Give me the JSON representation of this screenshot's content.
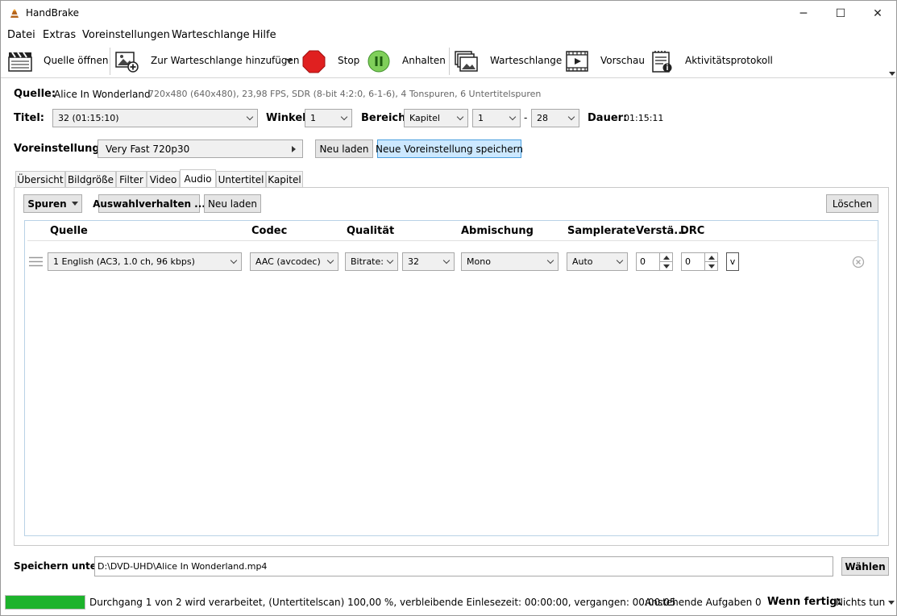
{
  "window": {
    "title": "HandBrake",
    "controls": {
      "minimize": "─",
      "maximize": "☐",
      "close": "✕"
    }
  },
  "menu": [
    "Datei",
    "Extras",
    "Voreinstellungen",
    "Warteschlange",
    "Hilfe"
  ],
  "toolbar": {
    "open_source": "Quelle öffnen",
    "add_to_queue": "Zur Warteschlange hinzufügen",
    "stop": "Stop",
    "pause": "Anhalten",
    "queue": "Warteschlange",
    "preview": "Vorschau",
    "activity_log": "Aktivitätsprotokoll"
  },
  "source": {
    "label": "Quelle:",
    "name": "Alice In Wonderland",
    "info": "720x480 (640x480), 23,98 FPS, SDR (8-bit 4:2:0, 6-1-6), 4 Tonspuren, 6 Untertitelspuren"
  },
  "title_row": {
    "title_label": "Titel:",
    "title_value": "32  (01:15:10)",
    "angle_label": "Winkel:",
    "angle_value": "1",
    "range_label": "Bereich:",
    "range_type": "Kapitel",
    "range_from": "1",
    "range_sep": "-",
    "range_to": "28",
    "duration_label": "Dauer:",
    "duration_value": "01:15:11"
  },
  "preset": {
    "label": "Voreinstellung:",
    "value": "Very Fast 720p30",
    "reload": "Neu laden",
    "save_new": "Neue Voreinstellung speichern"
  },
  "tabs": [
    "Übersicht",
    "Bildgröße",
    "Filter",
    "Video",
    "Audio",
    "Untertitel",
    "Kapitel"
  ],
  "audio": {
    "tracks_btn": "Spuren",
    "selection_btn": "Auswahlverhalten ...",
    "reload_btn": "Neu laden",
    "clear_btn": "Löschen",
    "columns": [
      "Quelle",
      "Codec",
      "Qualität",
      "Abmischung",
      "Samplerate",
      "Verstä...",
      "DRC"
    ],
    "track": {
      "source": "1 English (AC3, 1.0 ch, 96 kbps)",
      "codec": "AAC (avcodec)",
      "quality_mode": "Bitrate:",
      "bitrate": "32",
      "mixdown": "Mono",
      "samplerate": "Auto",
      "gain": "0",
      "drc": "0",
      "more": "v"
    }
  },
  "save": {
    "label": "Speichern unter:",
    "path": "D:\\DVD-UHD\\Alice In Wonderland.mp4",
    "browse": "Wählen"
  },
  "status": {
    "progress": 1.0,
    "text": "Durchgang 1 von 2 wird verarbeitet, (Untertitelscan) 100,00 %, verbleibende Einlesezeit: 00:00:00, vergangen: 00:00:05",
    "pending": "Anstehende Aufgaben 0",
    "when_done_label": "Wenn fertig:",
    "when_done_value": "Nichts tun"
  },
  "colors": {
    "accent": "#cce8ff",
    "stop": "#e02020",
    "pause": "#44aa33",
    "progress": "#1db32c"
  }
}
